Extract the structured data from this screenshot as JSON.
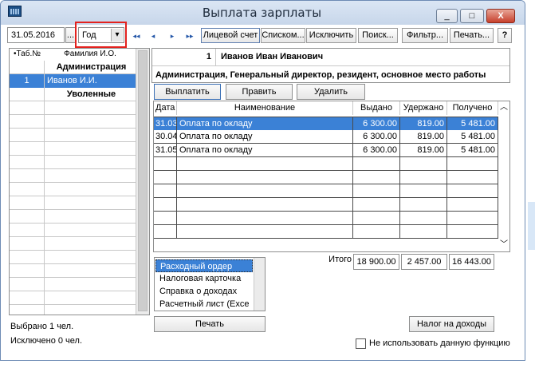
{
  "window": {
    "title": "Выплата зарплаты",
    "minimize": "_",
    "maximize": "□",
    "close": "X"
  },
  "toolbar": {
    "date": "31.05.2016",
    "date_btn": "...",
    "period": "Год",
    "period_arrow": "▾",
    "nav": [
      "◂◂",
      "◂",
      "▸",
      "▸▸"
    ],
    "buttons": [
      "Лицевой счет",
      "Списком...",
      "Исключить",
      "Поиск...",
      "Фильтр...",
      "Печать..."
    ],
    "help": "?"
  },
  "left_grid": {
    "col_tab": "•Таб.№",
    "col_name": "Фамилия И.О.",
    "rows": [
      {
        "tab": "",
        "name": "Администрация",
        "kind": "group"
      },
      {
        "tab": "1",
        "name": "Иванов И.И.",
        "kind": "selected"
      },
      {
        "tab": "",
        "name": "Уволенные",
        "kind": "group"
      }
    ],
    "selected_count": "Выбрано 1 чел.",
    "excluded_count": "Исключено 0 чел."
  },
  "employee": {
    "tab": "1",
    "name": "Иванов Иван Иванович",
    "details": "Администрация, Генеральный директор, резидент, основное место работы"
  },
  "actions": {
    "pay": "Выплатить",
    "edit": "Править",
    "delete": "Удалить"
  },
  "payments": {
    "columns": [
      "Дата",
      "Наименование",
      "Выдано",
      "Удержано",
      "Получено"
    ],
    "rows": [
      {
        "date": "31.03",
        "name": "Оплата по окладу",
        "issued": "6 300.00",
        "withheld": "819.00",
        "received": "5 481.00",
        "selected": true
      },
      {
        "date": "30.04",
        "name": "Оплата по окладу",
        "issued": "6 300.00",
        "withheld": "819.00",
        "received": "5 481.00",
        "selected": false
      },
      {
        "date": "31.05",
        "name": "Оплата по окладу",
        "issued": "6 300.00",
        "withheld": "819.00",
        "received": "5 481.00",
        "selected": false
      }
    ],
    "total_label": "Итого",
    "total_issued": "18 900.00",
    "total_withheld": "2 457.00",
    "total_received": "16 443.00"
  },
  "reports": {
    "items": [
      "Расходный ордер",
      "Налоговая карточка",
      "Справка о доходах",
      "Расчетный лист (Exce"
    ],
    "selected_index": 0
  },
  "bottom": {
    "print": "Печать",
    "tax": "Налог на доходы",
    "disable_label": "Не использовать данную функцию"
  },
  "colors": {
    "selection": "#3b81d6",
    "highlight_box": "#e3221e",
    "nav_arrows": "#2457a8"
  }
}
